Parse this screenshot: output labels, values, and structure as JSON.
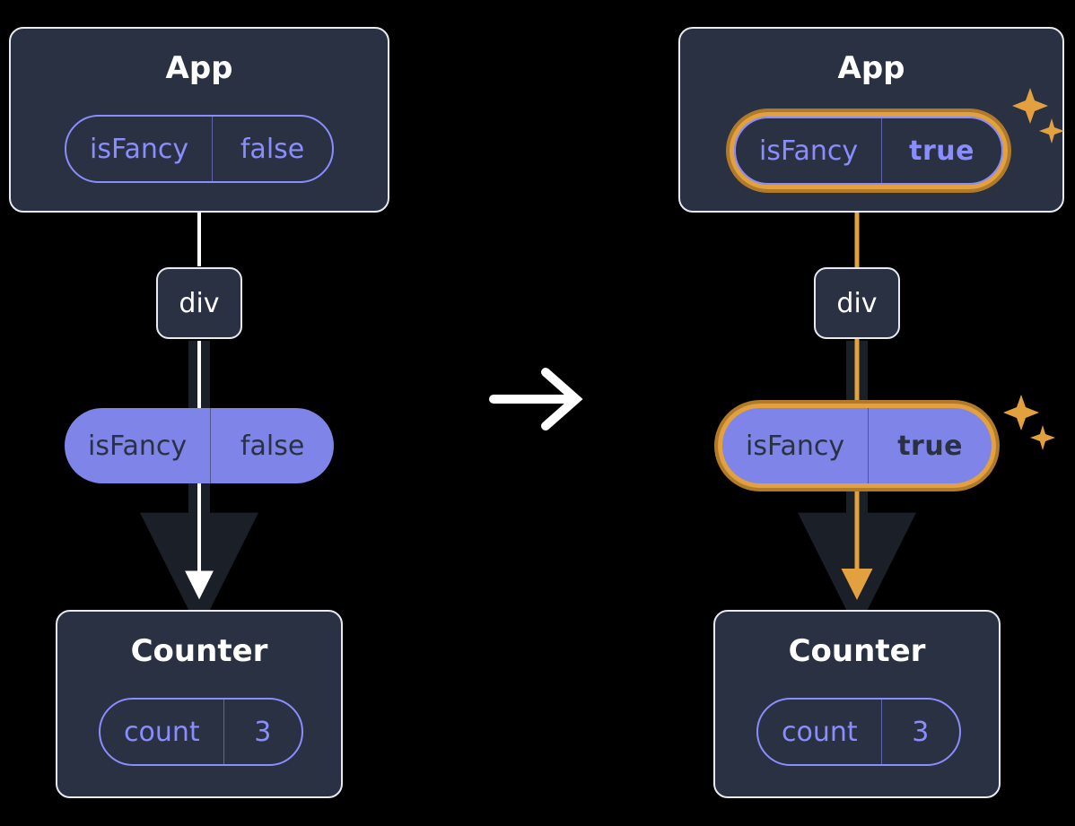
{
  "left": {
    "app": {
      "title": "App",
      "state": {
        "key": "isFancy",
        "value": "false"
      }
    },
    "div": {
      "label": "div"
    },
    "prop": {
      "key": "isFancy",
      "value": "false"
    },
    "counter": {
      "title": "Counter",
      "state": {
        "key": "count",
        "value": "3"
      }
    }
  },
  "right": {
    "app": {
      "title": "App",
      "state": {
        "key": "isFancy",
        "value": "true"
      }
    },
    "div": {
      "label": "div"
    },
    "prop": {
      "key": "isFancy",
      "value": "true"
    },
    "counter": {
      "title": "Counter",
      "state": {
        "key": "count",
        "value": "3"
      }
    }
  },
  "colors": {
    "panel": "#2a3142",
    "purple": "#8a8dff",
    "orange": "#e2a03f"
  }
}
